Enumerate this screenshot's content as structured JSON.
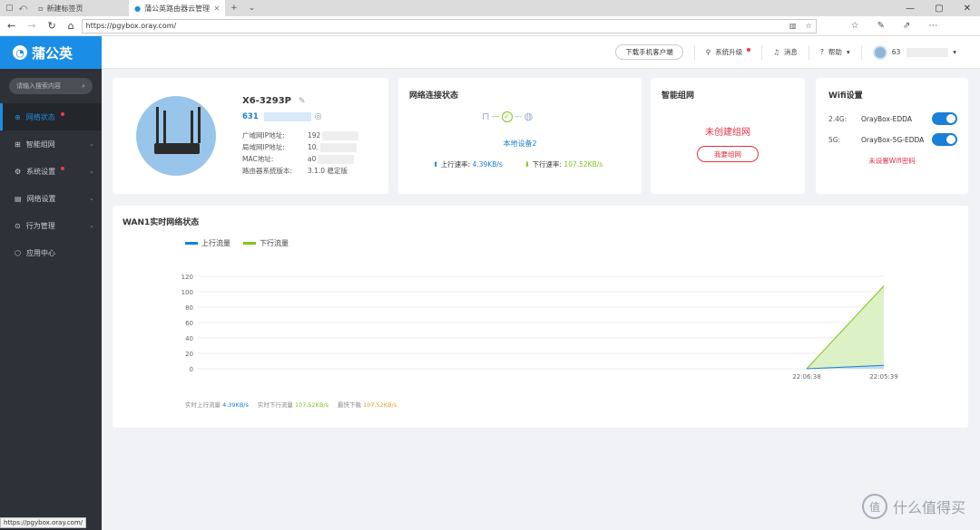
{
  "browser": {
    "tabs": [
      {
        "title": "新建标签页",
        "active": false
      },
      {
        "title": "蒲公英路由器云管理",
        "active": true
      }
    ],
    "url": "https://pgybox.oray.com/",
    "status_url": "https://pgybox.oray.com/"
  },
  "sidebar": {
    "brand": "蒲公英",
    "search_placeholder": "请输入搜索内容",
    "items": [
      {
        "label": "网络状态",
        "active": true,
        "dot": true
      },
      {
        "label": "智能组网",
        "chevron": true
      },
      {
        "label": "系统设置",
        "dot": true,
        "chevron": true
      },
      {
        "label": "网络设置",
        "chevron": true
      },
      {
        "label": "行为管理",
        "chevron": true
      },
      {
        "label": "应用中心"
      }
    ]
  },
  "topbar": {
    "download": "下载手机客户端",
    "upgrade": "系统升级",
    "messages": "消息",
    "help": "帮助",
    "user": "63"
  },
  "device": {
    "model": "X6-3293P",
    "sn": "631",
    "rows": [
      {
        "k": "广域网IP地址:",
        "v": "192"
      },
      {
        "k": "局域网IP地址:",
        "v": "10."
      },
      {
        "k": "MAC地址:",
        "v": "a0"
      },
      {
        "k": "路由器系统版本:",
        "v": "3.1.0 稳定版"
      }
    ]
  },
  "network": {
    "title": "网络连接状态",
    "device_label": "本地设备2",
    "up_label": "上行速率:",
    "up_value": "4.39KB/s",
    "down_label": "下行速率:",
    "down_value": "107.52KB/s"
  },
  "smart": {
    "title": "智能组网",
    "status": "未创建组网",
    "button": "我要组网"
  },
  "wifi": {
    "title": "Wifi设置",
    "bands": [
      {
        "band": "2.4G:",
        "ssid": "OrayBox-EDDA",
        "on": true
      },
      {
        "band": "5G:",
        "ssid": "OrayBox-5G-EDDA",
        "on": true
      }
    ],
    "warning": "未设置Wifi密码"
  },
  "chart_card": {
    "title": "WAN1实时网络状态",
    "footer": [
      {
        "label": "实时上行流量",
        "value": "4.39KB/s",
        "color": "#1a7fd6"
      },
      {
        "label": "实时下行流量",
        "value": "107.52KB/s",
        "color": "#7cc41f"
      },
      {
        "label": "最快下载",
        "value": "107.52KB/s",
        "color": "#e2a02a"
      }
    ]
  },
  "chart_data": {
    "type": "area",
    "x": [
      "22:06:38",
      "22:05:39"
    ],
    "yticks": [
      0,
      20,
      40,
      60,
      80,
      100,
      120
    ],
    "ylim": [
      0,
      120
    ],
    "series": [
      {
        "name": "上行流量",
        "color": "#1a7fd6",
        "values": [
          0,
          4.39
        ]
      },
      {
        "name": "下行流量",
        "color": "#7cc41f",
        "values": [
          0,
          107.52
        ]
      }
    ]
  },
  "watermark": "什么值得买"
}
